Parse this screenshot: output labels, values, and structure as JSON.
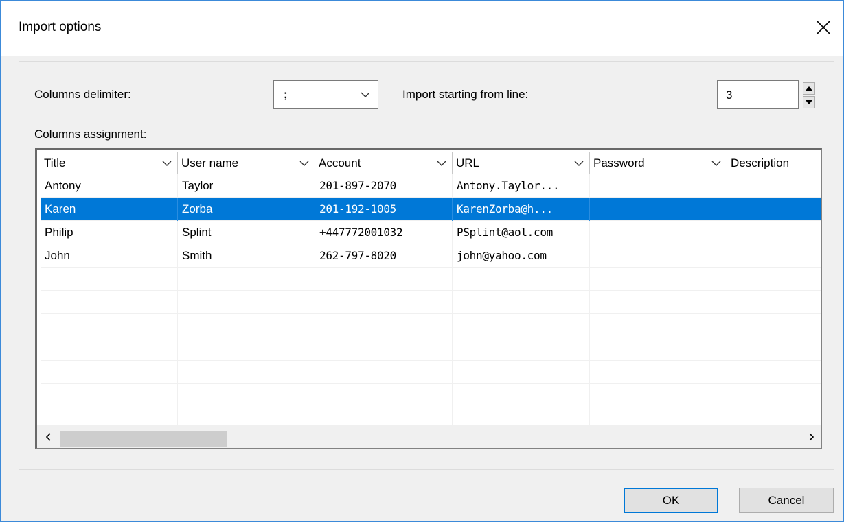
{
  "dialog": {
    "title": "Import options",
    "close_icon": "close-icon"
  },
  "options": {
    "delimiter_label": "Columns delimiter:",
    "delimiter_value": ";",
    "start_line_label": "Import starting from line:",
    "start_line_value": "3",
    "assignment_label": "Columns assignment:"
  },
  "grid": {
    "columns": [
      "Title",
      "User name",
      "Account",
      "URL",
      "Password",
      "Description"
    ],
    "rows": [
      [
        "Antony",
        "Taylor",
        "201-897-2070",
        "Antony.Taylor...",
        "",
        ""
      ],
      [
        "Karen",
        "Zorba",
        "201-192-1005",
        "KarenZorba@h...",
        "",
        ""
      ],
      [
        "Philip",
        "Splint",
        "+447772001032",
        "PSplint@aol.com",
        "",
        ""
      ],
      [
        "John",
        "Smith",
        "262-797-8020",
        "john@yahoo.com",
        "",
        ""
      ]
    ],
    "selected_row_index": 1,
    "empty_rows": 7,
    "horizontal_scroll_position": 0
  },
  "buttons": {
    "ok": "OK",
    "cancel": "Cancel"
  },
  "colors": {
    "selection": "#0078d7",
    "focus_border": "#0078d7",
    "window_border": "#3c8ad9"
  }
}
